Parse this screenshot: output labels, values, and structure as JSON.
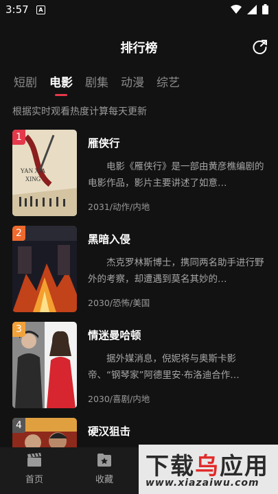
{
  "status": {
    "time": "3:57",
    "notif_glyph": "A"
  },
  "header": {
    "title": "排行榜"
  },
  "tabs": [
    {
      "label": "短剧",
      "active": false
    },
    {
      "label": "电影",
      "active": true
    },
    {
      "label": "剧集",
      "active": false
    },
    {
      "label": "动漫",
      "active": false
    },
    {
      "label": "综艺",
      "active": false
    }
  ],
  "subtitle": "根据实时观看热度计算每天更新",
  "rank_colors": [
    "#e5384a",
    "#ee6a2e",
    "#f2a23a",
    "#555555"
  ],
  "items": [
    {
      "rank": "1",
      "title": "雁侠行",
      "desc": "电影《雁侠行》是一部由黄彦樵编剧的电影作品，影片主要讲述了如意…",
      "meta": "2031/动作/内地",
      "poster_text": "YAN XIA XING"
    },
    {
      "rank": "2",
      "title": "黑暗入侵",
      "desc": "杰克罗林斯博士，携同两名助手进行野外的考察，却遭遇到莫名其妙的…",
      "meta": "2030/恐怖/美国"
    },
    {
      "rank": "3",
      "title": "情迷曼哈顿",
      "desc": "据外媒消息，倪妮将与奥斯卡影帝、“钢琴家”阿德里安·布洛迪合作…",
      "meta": "2030/喜剧/内地"
    },
    {
      "rank": "4",
      "title": "硬汉狙击",
      "desc": "",
      "meta": ""
    }
  ],
  "nav": [
    {
      "label": "首页",
      "icon": "clapperboard-icon"
    },
    {
      "label": "收藏",
      "icon": "star-folder-icon"
    }
  ],
  "watermark": {
    "big_1": "下载",
    "big_2": "乌",
    "big_3": "应用",
    "small": "www.xiazaiwu.com"
  }
}
